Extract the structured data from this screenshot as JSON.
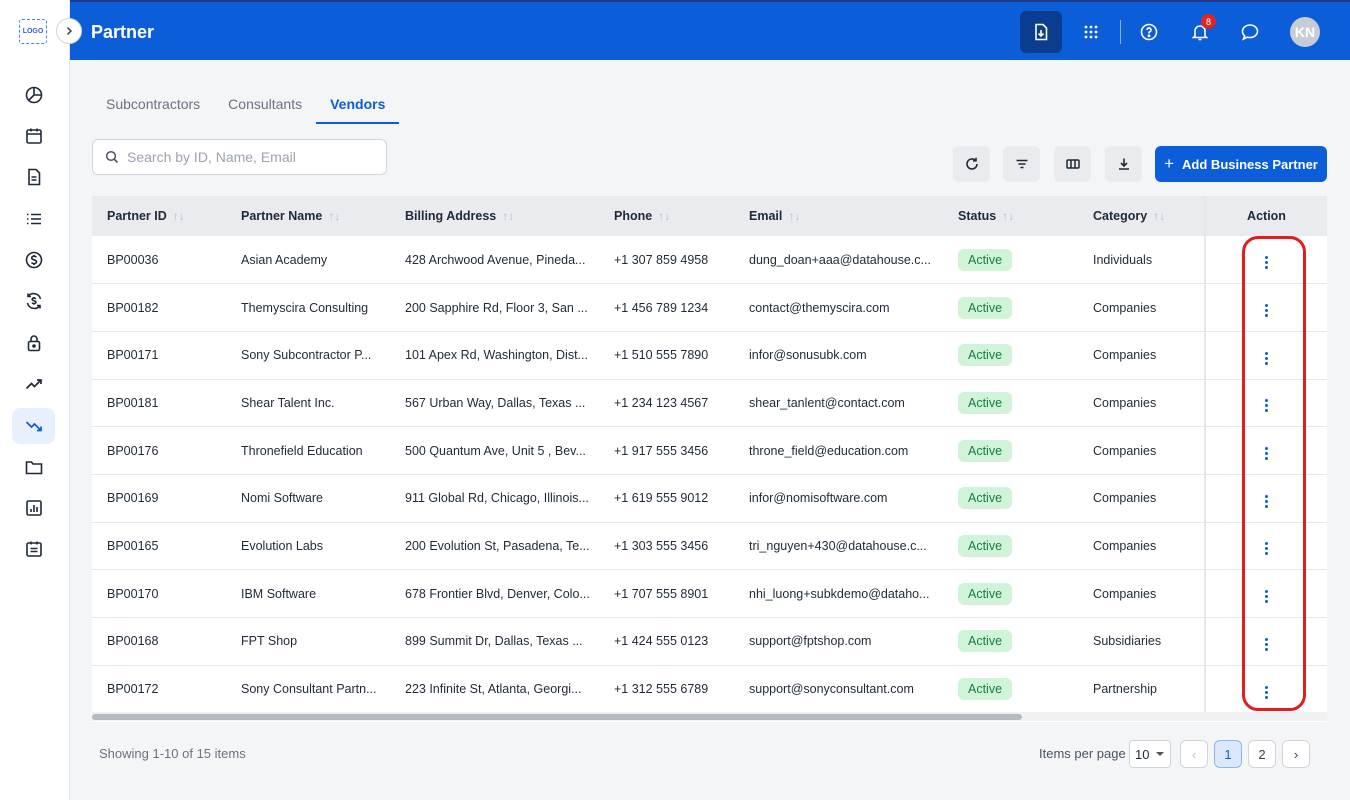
{
  "logo": "LOGO",
  "header": {
    "title": "Partner",
    "notification_count": "8",
    "avatar_initials": "KN"
  },
  "tabs": [
    {
      "label": "Subcontractors",
      "active": false
    },
    {
      "label": "Consultants",
      "active": false
    },
    {
      "label": "Vendors",
      "active": true
    }
  ],
  "search": {
    "placeholder": "Search by ID, Name, Email",
    "value": ""
  },
  "toolbar": {
    "add_label": "Add Business Partner"
  },
  "table": {
    "columns": [
      "Partner ID",
      "Partner Name",
      "Billing Address",
      "Phone",
      "Email",
      "Status",
      "Category",
      "Action"
    ],
    "rows": [
      {
        "id": "BP00036",
        "name": "Asian Academy",
        "address": "428 Archwood Avenue, Pineda...",
        "phone": "+1 307 859 4958",
        "email": "dung_doan+aaa@datahouse.c...",
        "status": "Active",
        "category": "Individuals"
      },
      {
        "id": "BP00182",
        "name": "Themyscira Consulting",
        "address": "200 Sapphire Rd, Floor 3, San ...",
        "phone": "+1 456 789 1234",
        "email": "contact@themyscira.com",
        "status": "Active",
        "category": "Companies"
      },
      {
        "id": "BP00171",
        "name": "Sony Subcontractor P...",
        "address": "101 Apex Rd, Washington, Dist...",
        "phone": "+1 510 555 7890",
        "email": "infor@sonusubk.com",
        "status": "Active",
        "category": "Companies"
      },
      {
        "id": "BP00181",
        "name": "Shear Talent Inc.",
        "address": "567 Urban Way, Dallas, Texas ...",
        "phone": "+1 234 123 4567",
        "email": "shear_tanlent@contact.com",
        "status": "Active",
        "category": "Companies"
      },
      {
        "id": "BP00176",
        "name": "Thronefield Education",
        "address": "500 Quantum Ave, Unit 5 , Bev...",
        "phone": "+1 917 555 3456",
        "email": "throne_field@education.com",
        "status": "Active",
        "category": "Companies"
      },
      {
        "id": "BP00169",
        "name": "Nomi Software",
        "address": "911 Global Rd, Chicago, Illinois...",
        "phone": "+1 619 555 9012",
        "email": "infor@nomisoftware.com",
        "status": "Active",
        "category": "Companies"
      },
      {
        "id": "BP00165",
        "name": "Evolution Labs",
        "address": "200 Evolution St, Pasadena, Te...",
        "phone": "+1 303 555 3456",
        "email": "tri_nguyen+430@datahouse.c...",
        "status": "Active",
        "category": "Companies"
      },
      {
        "id": "BP00170",
        "name": "IBM Software",
        "address": "678 Frontier Blvd, Denver, Colo...",
        "phone": "+1 707 555 8901",
        "email": "nhi_luong+subkdemo@dataho...",
        "status": "Active",
        "category": "Companies"
      },
      {
        "id": "BP00168",
        "name": "FPT Shop",
        "address": "899 Summit Dr, Dallas, Texas ...",
        "phone": "+1 424 555 0123",
        "email": "support@fptshop.com",
        "status": "Active",
        "category": "Subsidiaries"
      },
      {
        "id": "BP00172",
        "name": "Sony Consultant Partn...",
        "address": "223 Infinite St, Atlanta, Georgi...",
        "phone": "+1 312 555 6789",
        "email": "support@sonyconsultant.com",
        "status": "Active",
        "category": "Partnership"
      }
    ]
  },
  "footer": {
    "showing": "Showing 1-10 of 15 items",
    "items_per_page_label": "Items per page",
    "items_per_page": "10",
    "pages": [
      "1",
      "2"
    ],
    "current_page": "1"
  },
  "colors": {
    "primary": "#0b5ed7",
    "status_active_bg": "#d1f4d9",
    "status_active_text": "#15803d",
    "highlight": "#e11d1d"
  }
}
